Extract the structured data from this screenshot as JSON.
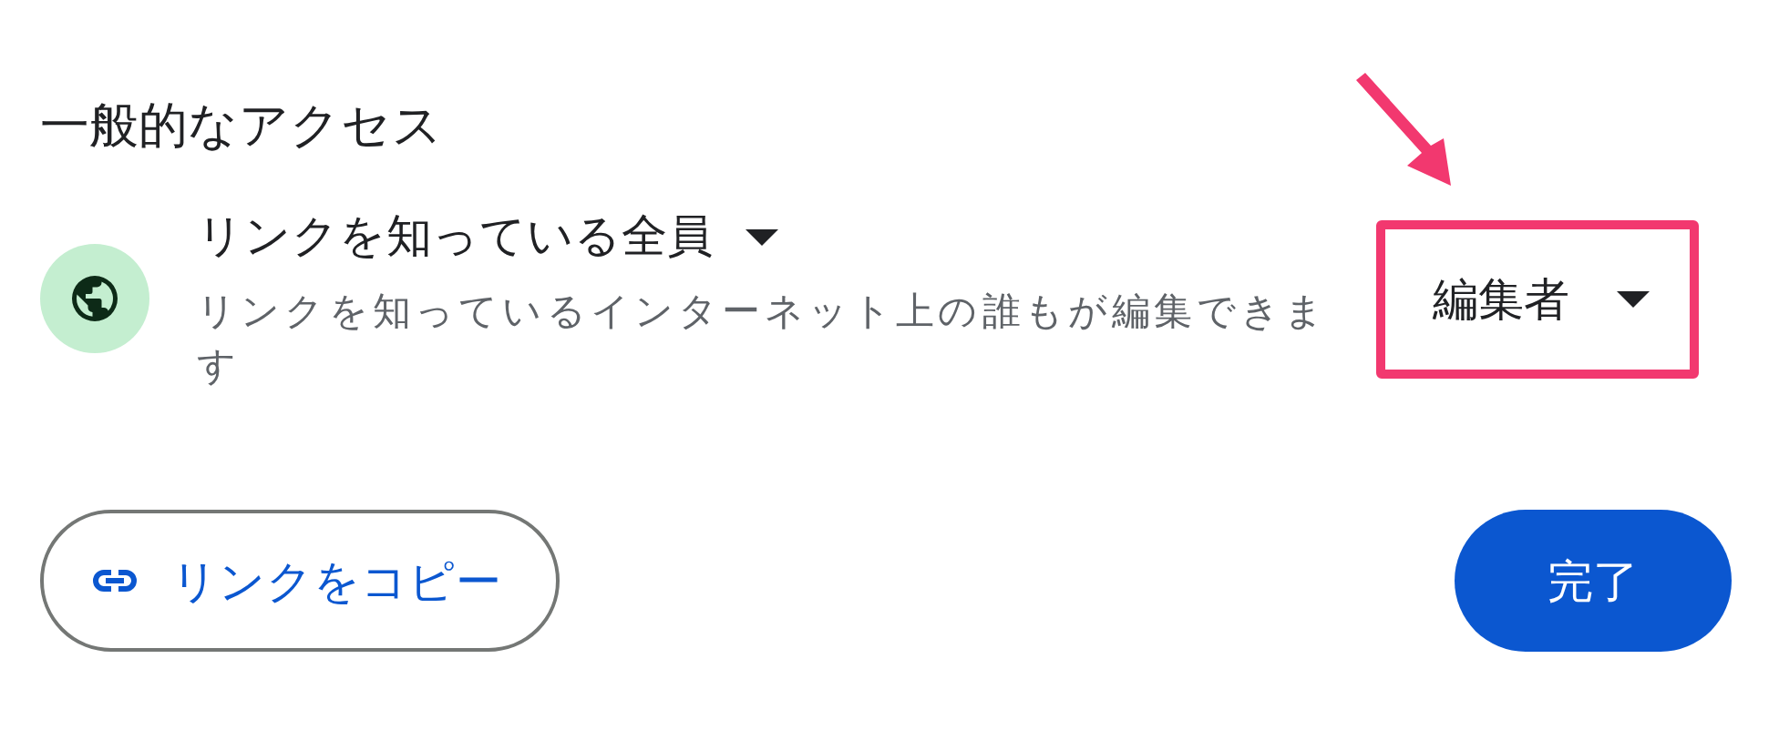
{
  "section_title": "一般的なアクセス",
  "access": {
    "scope": "リンクを知っている全員",
    "description": "リンクを知っているインターネット上の誰もが編集できます",
    "role": "編集者",
    "highlighted": true
  },
  "buttons": {
    "copy_link": "リンクをコピー",
    "done": "完了"
  }
}
